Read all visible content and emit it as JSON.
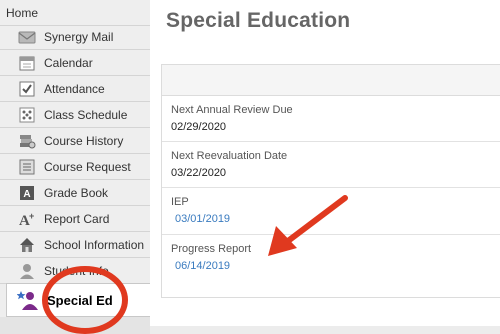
{
  "sidebar": {
    "home_label": "Home",
    "items": [
      {
        "label": "Synergy Mail",
        "icon": "mail-icon"
      },
      {
        "label": "Calendar",
        "icon": "calendar-icon"
      },
      {
        "label": "Attendance",
        "icon": "attendance-check-icon"
      },
      {
        "label": "Class Schedule",
        "icon": "schedule-grid-icon"
      },
      {
        "label": "Course History",
        "icon": "history-books-icon"
      },
      {
        "label": "Course Request",
        "icon": "course-request-icon"
      },
      {
        "label": "Grade Book",
        "icon": "grade-book-icon"
      },
      {
        "label": "Report Card",
        "icon": "report-card-icon"
      },
      {
        "label": "School Information",
        "icon": "school-house-icon"
      },
      {
        "label": "Student Info",
        "icon": "student-icon"
      }
    ],
    "active_item": {
      "label": "Special Ed",
      "icon": "special-ed-icon"
    }
  },
  "main": {
    "title": "Special Education",
    "fields": [
      {
        "label": "Next Annual Review Due",
        "value": "02/29/2020",
        "link": false
      },
      {
        "label": "Next Reevaluation Date",
        "value": "03/22/2020",
        "link": false
      },
      {
        "label": "IEP",
        "value": "03/01/2019",
        "link": true
      },
      {
        "label": "Progress Report",
        "value": "06/14/2019",
        "link": true
      }
    ]
  },
  "annotations": {
    "color": "#e0391f"
  }
}
